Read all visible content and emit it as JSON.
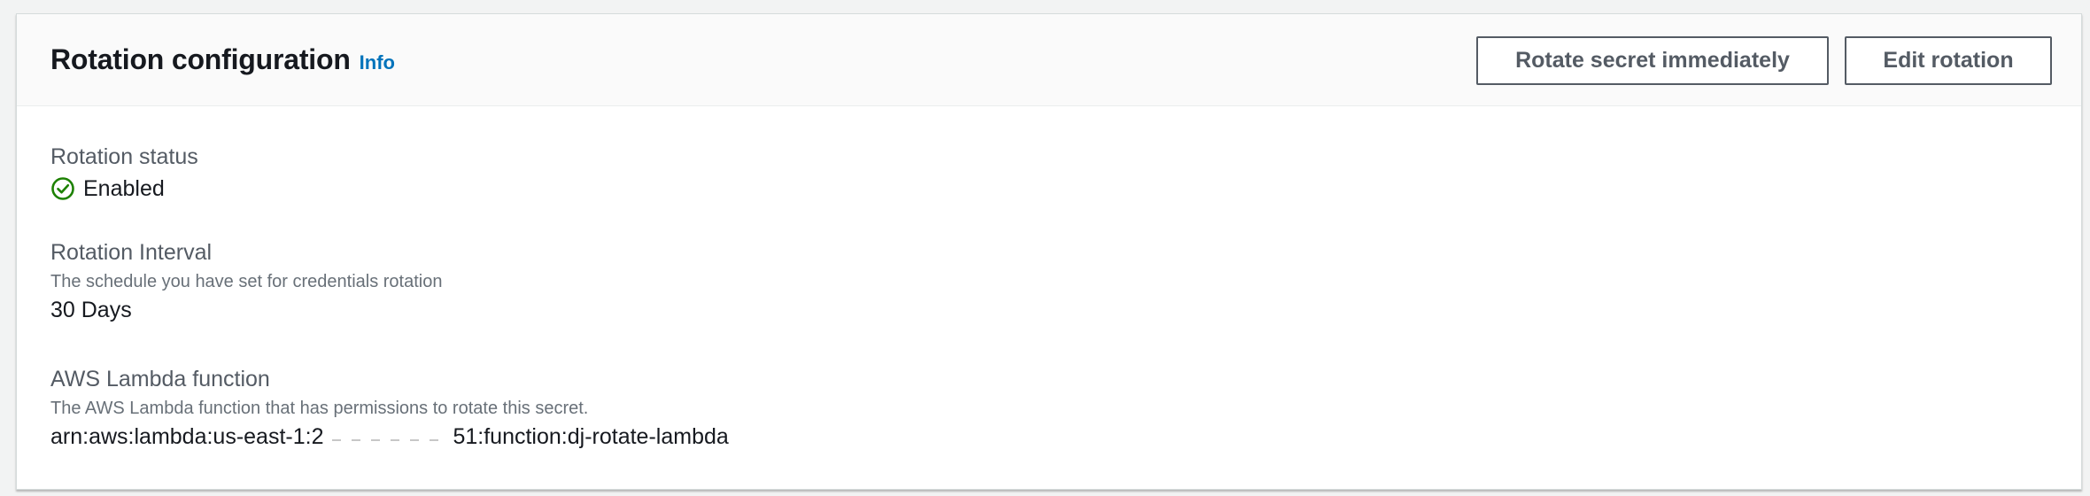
{
  "header": {
    "title": "Rotation configuration",
    "info_link": "Info",
    "buttons": {
      "rotate_label": "Rotate secret immediately",
      "edit_label": "Edit rotation"
    }
  },
  "fields": {
    "rotation_status": {
      "label": "Rotation status",
      "value": "Enabled",
      "icon": "check-circle-icon",
      "status_color": "#1d8102"
    },
    "rotation_interval": {
      "label": "Rotation Interval",
      "description": "The schedule you have set for credentials rotation",
      "value": "30 Days"
    },
    "lambda_function": {
      "label": "AWS Lambda function",
      "description": "The AWS Lambda function that has permissions to rotate this secret.",
      "value_prefix": "arn:aws:lambda:us-east-1:2",
      "value_suffix": "51:function:dj-rotate-lambda"
    }
  },
  "colors": {
    "link": "#0073bb",
    "button_border": "#545b64",
    "success": "#1d8102"
  }
}
